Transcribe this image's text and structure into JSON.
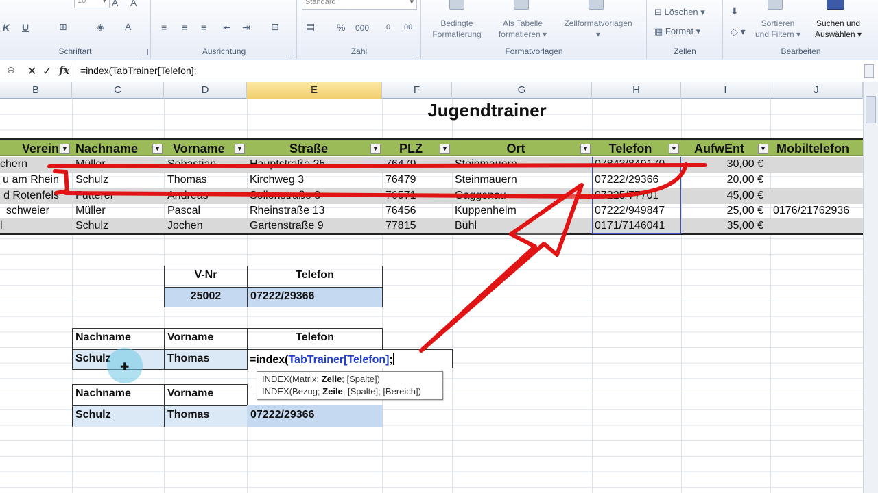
{
  "ribbon": {
    "groups": {
      "font": "Schriftart",
      "alignment": "Ausrichtung",
      "number": "Zahl",
      "styles": "Formatvorlagen",
      "cells": "Zellen",
      "edit": "Bearbeiten"
    },
    "font_size": "10",
    "number_format": "Standard",
    "number_buttons": [
      "%",
      "000"
    ],
    "style_buttons": {
      "conditional_1": "Bedingte",
      "conditional_2": "Formatierung",
      "as_table_1": "Als Tabelle",
      "as_table_2": "formatieren",
      "cell_styles": "Zellformatvorlagen"
    },
    "cell_buttons": {
      "delete": "Löschen",
      "format": "Format"
    },
    "edit_buttons": {
      "sort_1": "Sortieren",
      "sort_2": "und Filtern",
      "find_1": "Suchen und",
      "find_2": "Auswählen"
    }
  },
  "formula_bar": {
    "formula": "=index(TabTrainer[Telefon];",
    "fx": "fx"
  },
  "columns": [
    "B",
    "C",
    "D",
    "E",
    "F",
    "G",
    "H",
    "I",
    "J"
  ],
  "sheet_title": "Jugendtrainer",
  "table": {
    "headers": [
      "Verein",
      "Nachname",
      "Vorname",
      "Straße",
      "PLZ",
      "Ort",
      "Telefon",
      "AufwEnt",
      "Mobiltelefon"
    ],
    "rows": [
      [
        "chern",
        "Müller",
        "Sebastian",
        "Hauptstraße 25",
        "76479",
        "Steinmauern",
        "07843/849170",
        "30,00 €",
        ""
      ],
      [
        "u am Rhein",
        "Schulz",
        "Thomas",
        "Kirchweg 3",
        "76479",
        "Steinmauern",
        "07222/29366",
        "20,00 €",
        ""
      ],
      [
        "d Rotenfels",
        "Futterer",
        "Andreas",
        "Sollenstraße 3",
        "76571",
        "Gaggenau",
        "07225/77701",
        "45,00 €",
        ""
      ],
      [
        "schweier",
        "Müller",
        "Pascal",
        "Rheinstraße 13",
        "76456",
        "Kuppenheim",
        "07222/949847",
        "25,00 €",
        "0176/21762936"
      ],
      [
        "l",
        "Schulz",
        "Jochen",
        "Gartenstraße 9",
        "77815",
        "Bühl",
        "0171/7146041",
        "35,00 €",
        ""
      ]
    ]
  },
  "lookup1": {
    "h_vnr": "V-Nr",
    "h_tel": "Telefon",
    "vnr": "25002",
    "tel": "07222/29366"
  },
  "lookup2": {
    "h_nach": "Nachname",
    "h_vor": "Vorname",
    "h_tel": "Telefon",
    "nach": "Schulz",
    "vor": "Thomas",
    "formula_start": "=index(",
    "formula_ref": "TabTrainer[Telefon]",
    "formula_end": ";"
  },
  "tooltip": {
    "line1_pre": "INDEX(Matrix; ",
    "line1_bold": "Zeile",
    "line1_post": "; [Spalte])",
    "line2_pre": "INDEX(Bezug; ",
    "line2_bold": "Zeile",
    "line2_post": "; [Spalte]; [Bereich])"
  },
  "lookup3": {
    "h_nach": "Nachname",
    "h_vor": "Vorname",
    "nach": "Schulz",
    "vor": "Thomas",
    "tel": "07222/29366"
  },
  "colors": {
    "table_header": "#9bbb59",
    "band": "#d9d9d9",
    "highlight": "#c5d9f1",
    "annotation": "#e01414"
  }
}
